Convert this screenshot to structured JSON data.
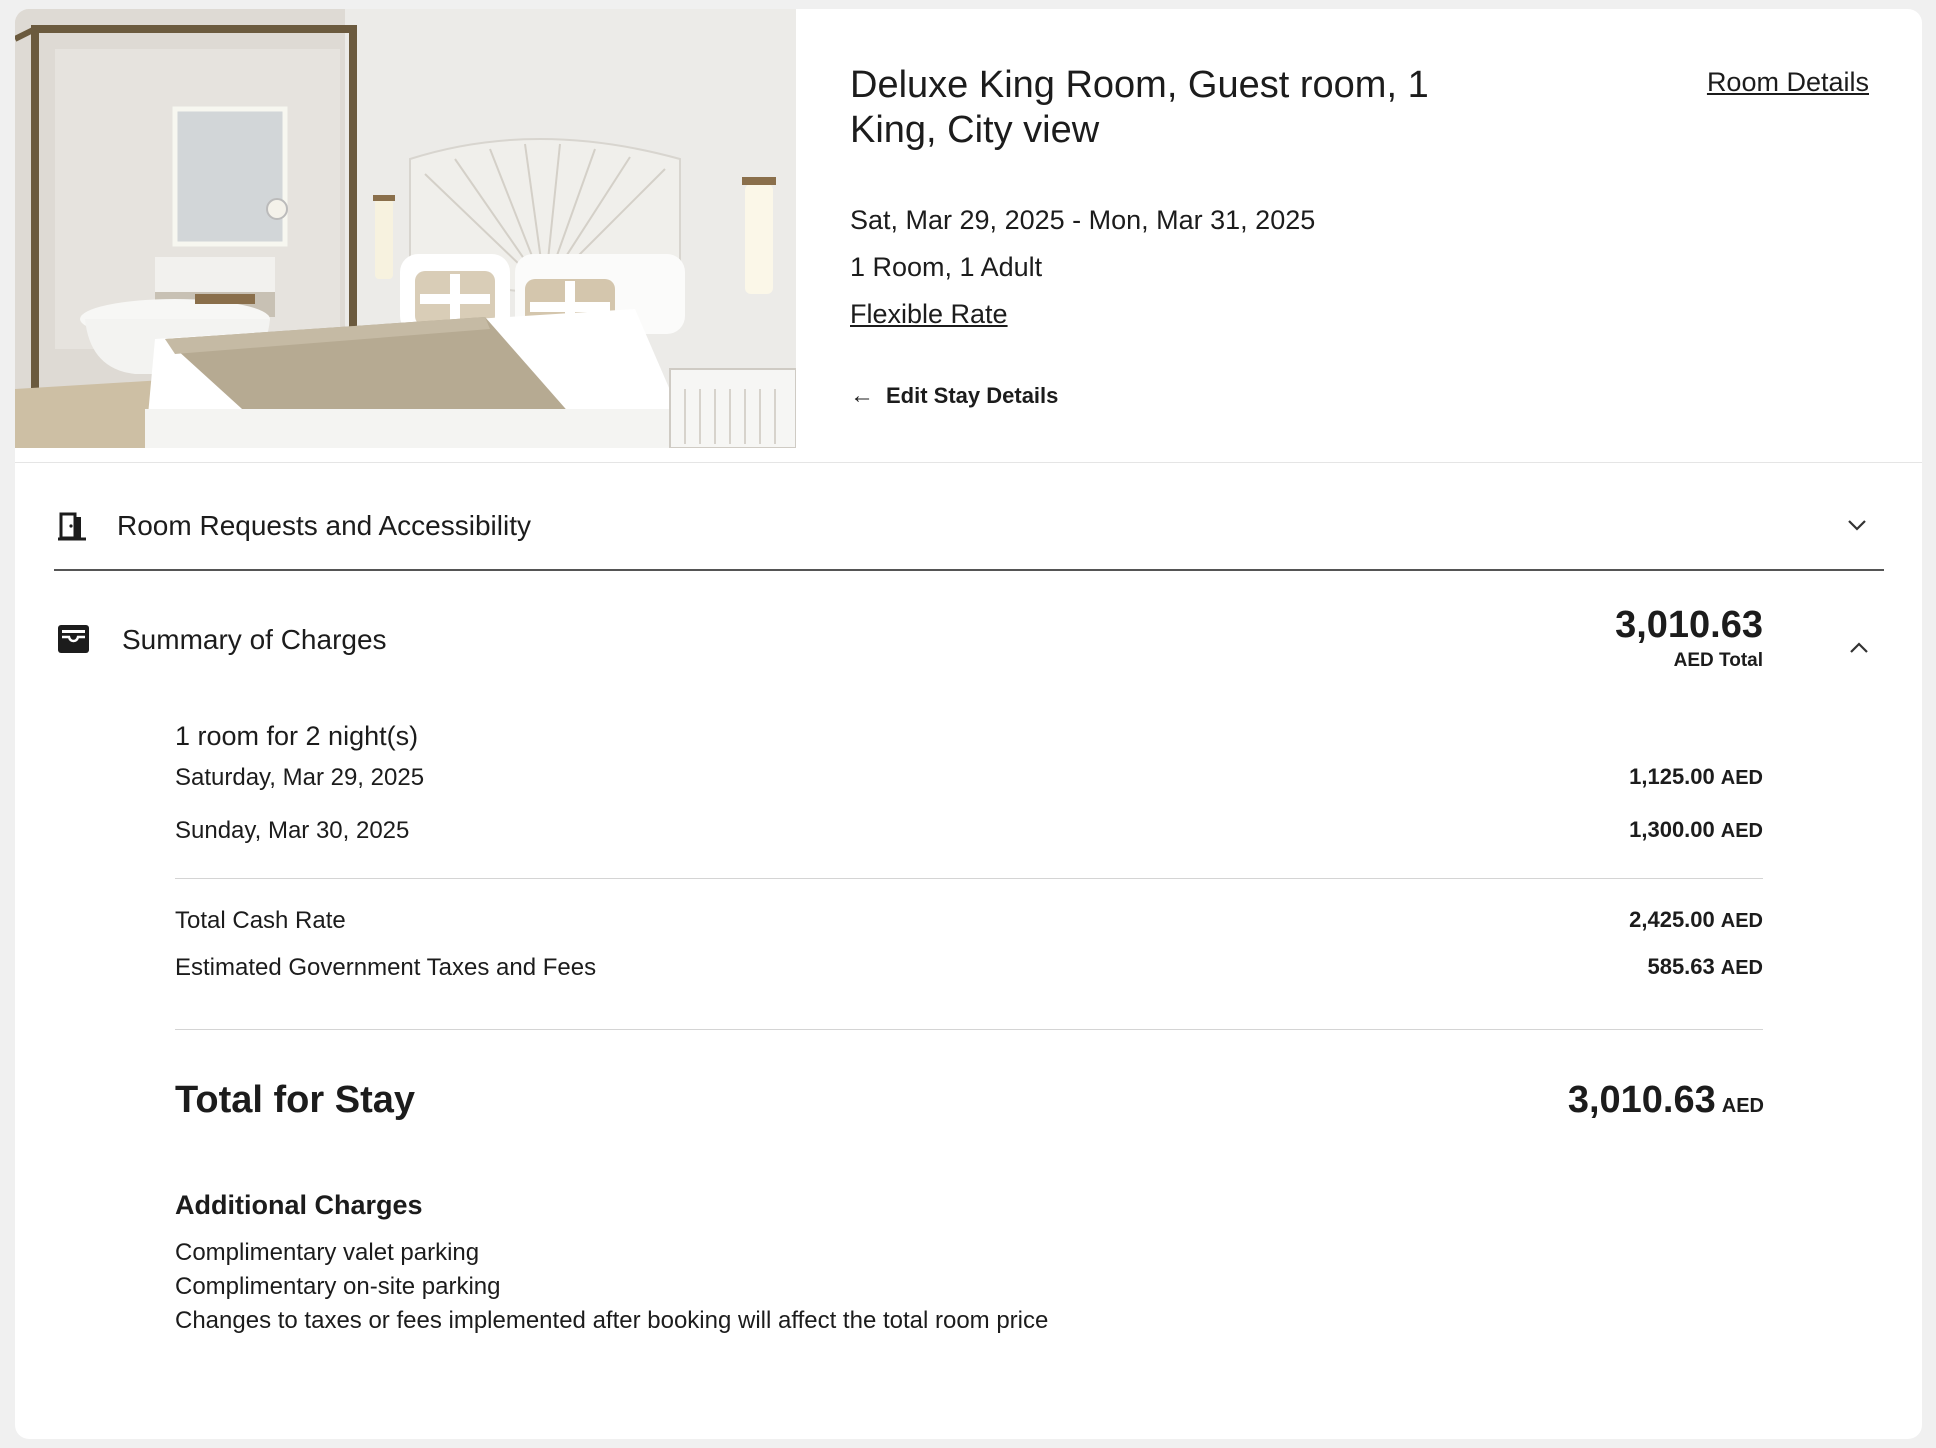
{
  "room": {
    "image_alt": "Deluxe King Room photo",
    "title": "Deluxe King Room, Guest room, 1 King, City view",
    "details_link": "Room Details",
    "dates": "Sat, Mar 29, 2025 - Mon, Mar 31, 2025",
    "occupancy": "1 Room, 1 Adult",
    "rate_name": "Flexible Rate",
    "edit_stay": "Edit Stay Details"
  },
  "requests": {
    "label": "Room Requests and Accessibility",
    "icon": "hotel-door-icon",
    "expanded": false
  },
  "summary": {
    "label": "Summary of Charges",
    "icon": "folder-tray-icon",
    "total_amount": "3,010.63",
    "total_sub": "AED Total",
    "expanded": true,
    "nights_heading": "1 room for 2 night(s)",
    "nights": [
      {
        "date": "Saturday, Mar 29, 2025",
        "amount": "1,125.00",
        "currency": "AED"
      },
      {
        "date": "Sunday, Mar 30, 2025",
        "amount": "1,300.00",
        "currency": "AED"
      }
    ],
    "subtotals": [
      {
        "label": "Total Cash Rate",
        "amount": "2,425.00",
        "currency": "AED"
      },
      {
        "label": "Estimated Government Taxes and Fees",
        "amount": "585.63",
        "currency": "AED"
      }
    ],
    "total_for_stay": {
      "label": "Total for Stay",
      "amount": "3,010.63",
      "currency": "AED"
    },
    "additional": {
      "heading": "Additional Charges",
      "items": [
        "Complimentary valet parking",
        "Complimentary on-site parking",
        "Changes to taxes or fees implemented after booking will affect the total room price"
      ]
    }
  }
}
